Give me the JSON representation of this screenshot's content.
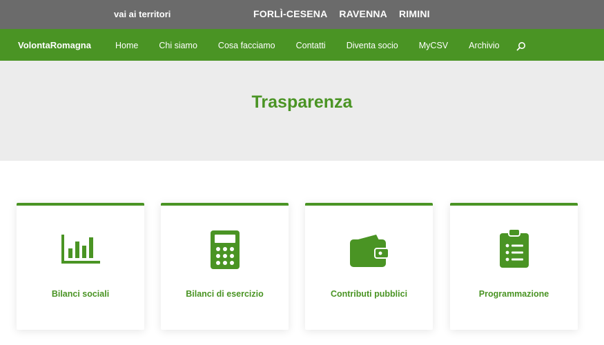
{
  "topbar": {
    "territori_label": "vai ai territori",
    "links": [
      "FORLÌ-CESENA",
      "RAVENNA",
      "RIMINI"
    ]
  },
  "navbar": {
    "brand": "VolontaRomagna",
    "items": [
      "Home",
      "Chi siamo",
      "Cosa facciamo",
      "Contatti",
      "Diventa socio",
      "MyCSV",
      "Archivio"
    ],
    "search_icon": "search-icon"
  },
  "hero": {
    "title": "Trasparenza"
  },
  "cards": [
    {
      "label": "Bilanci sociali",
      "icon": "bar-chart-icon"
    },
    {
      "label": "Bilanci di esercizio",
      "icon": "calculator-icon"
    },
    {
      "label": "Contributi pubblici",
      "icon": "wallet-icon"
    },
    {
      "label": "Programmazione",
      "icon": "clipboard-list-icon"
    }
  ],
  "colors": {
    "topbar": "#6b6b6b",
    "brand_green": "#4a9424",
    "hero_bg": "#ececec"
  }
}
